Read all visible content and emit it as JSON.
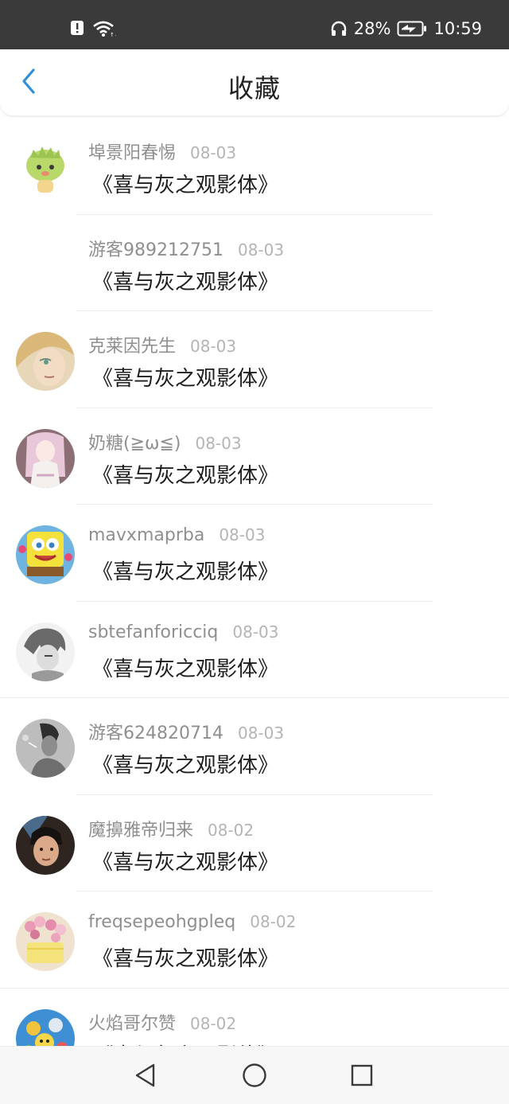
{
  "status_bar": {
    "battery": "28%",
    "time": "10:59",
    "icons": [
      "notification-icon",
      "wifi-icon",
      "headphone-icon",
      "battery-charging-icon"
    ]
  },
  "header": {
    "title": "收藏",
    "accent_color": "#2f8fd8"
  },
  "favorites": [
    {
      "user": "埠景阳春惕",
      "date": "08-03",
      "title": "《喜与灰之观影体》",
      "avatar": "cartoon-sprout"
    },
    {
      "user": "游客989212751",
      "date": "08-03",
      "title": "《喜与灰之观影体》",
      "avatar": "none"
    },
    {
      "user": "克莱因先生",
      "date": "08-03",
      "title": "《喜与灰之观影体》",
      "avatar": "anime-blond"
    },
    {
      "user": "奶糖(≧ω≦)",
      "date": "08-03",
      "title": "《喜与灰之观影体》",
      "avatar": "anime-pink"
    },
    {
      "user": "mavxmaprba",
      "date": "08-03",
      "title": "《喜与灰之观影体》",
      "avatar": "spongebob"
    },
    {
      "user": "sbtefanforicciq",
      "date": "08-03",
      "title": "《喜与灰之观影体》",
      "avatar": "anime-gray"
    },
    {
      "user": "游客624820714",
      "date": "08-03",
      "title": "《喜与灰之观影体》",
      "avatar": "photo-gray"
    },
    {
      "user": "魔擤雅帝归来",
      "date": "08-02",
      "title": "《喜与灰之观影体》",
      "avatar": "photo-dark"
    },
    {
      "user": "freqsepeohgpleq",
      "date": "08-02",
      "title": "《喜与灰之观影体》",
      "avatar": "flowers"
    },
    {
      "user": "火焰哥尔赞",
      "date": "08-02",
      "title": "《喜与灰之观影体》",
      "avatar": "cartoon-blue"
    }
  ],
  "nav_bar": {
    "buttons": [
      "back-triangle-icon",
      "home-circle-icon",
      "recents-square-icon"
    ]
  }
}
